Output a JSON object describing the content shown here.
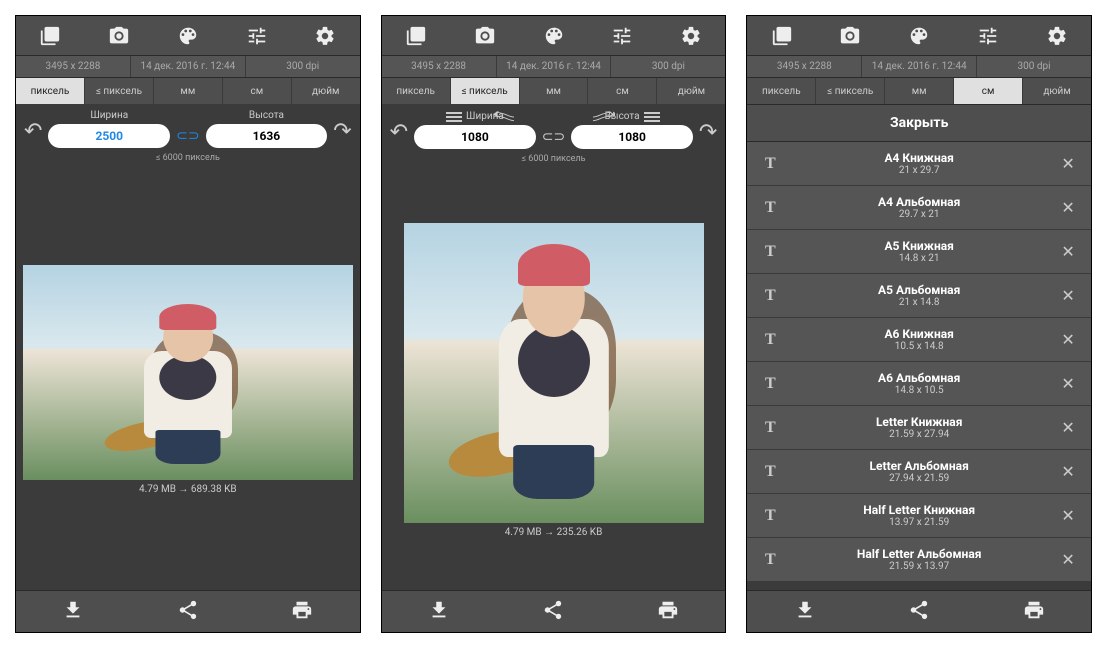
{
  "info": {
    "dimensions": "3495 x 2288",
    "date": "14 дек. 2016 г. 12:44",
    "dpi": "300 dpi"
  },
  "tabs": [
    "пиксель",
    "≤ пиксель",
    "мм",
    "см",
    "дюйм"
  ],
  "labels": {
    "width": "Ширина",
    "height": "Высота",
    "limit": "≤ 6000 пиксель",
    "close": "Закрыть"
  },
  "screen1": {
    "width": "2500",
    "height": "1636",
    "sizeInfo": "4.79 MB → 689.38 KB"
  },
  "screen2": {
    "width": "1080",
    "height": "1080",
    "sizeInfo": "4.79 MB → 235.26 KB"
  },
  "screen3": {
    "presets": [
      {
        "name": "A4 Книжная",
        "dim": "21 x 29.7"
      },
      {
        "name": "A4 Альбомная",
        "dim": "29.7 x 21"
      },
      {
        "name": "A5 Книжная",
        "dim": "14.8 x 21"
      },
      {
        "name": "A5 Альбомная",
        "dim": "21 x 14.8"
      },
      {
        "name": "A6 Книжная",
        "dim": "10.5 x 14.8"
      },
      {
        "name": "A6 Альбомная",
        "dim": "14.8 x 10.5"
      },
      {
        "name": "Letter Книжная",
        "dim": "21.59 x 27.94"
      },
      {
        "name": "Letter Альбомная",
        "dim": "27.94 x 21.59"
      },
      {
        "name": "Half Letter Книжная",
        "dim": "13.97 x 21.59"
      },
      {
        "name": "Half Letter Альбомная",
        "dim": "21.59 x 13.97"
      }
    ]
  }
}
